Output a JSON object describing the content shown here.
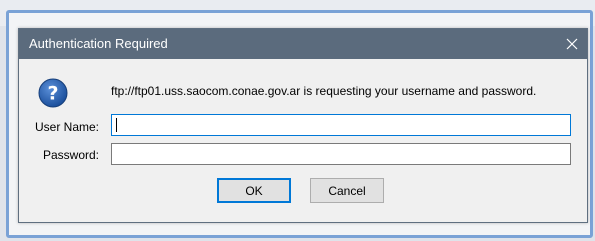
{
  "dialog": {
    "title": "Authentication Required",
    "message": "ftp://ftp01.uss.saocom.conae.gov.ar is requesting your username and password.",
    "icon": "question-icon",
    "accent_color": "#0078d7",
    "titlebar_color": "#5b6b7d"
  },
  "form": {
    "username_label": "User Name:",
    "username_value": "",
    "password_label": "Password:",
    "password_value": ""
  },
  "buttons": {
    "ok_label": "OK",
    "cancel_label": "Cancel"
  }
}
